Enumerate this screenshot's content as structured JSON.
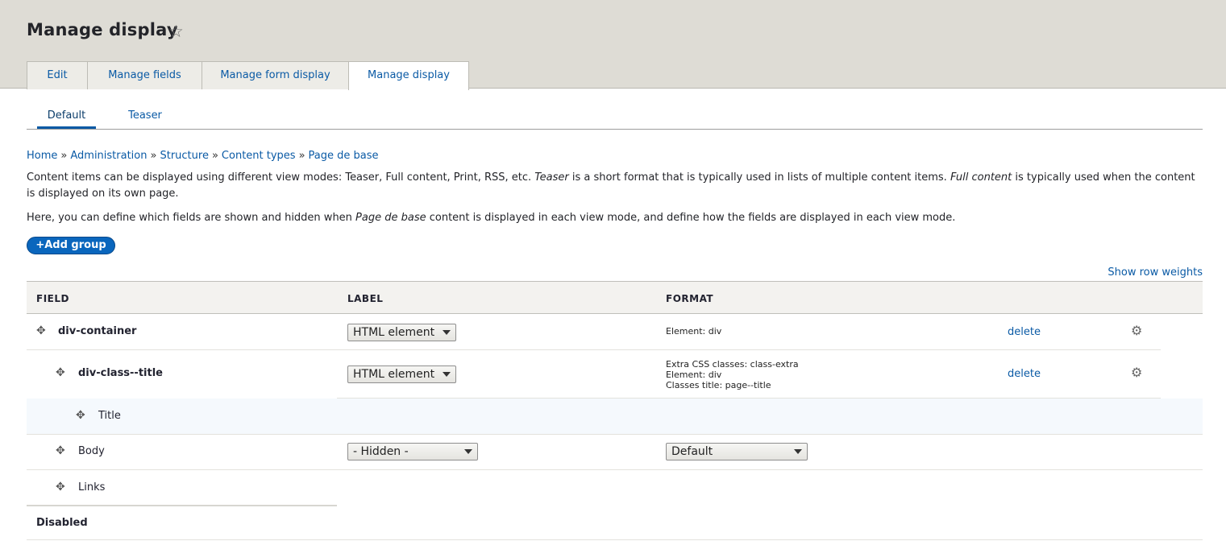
{
  "header": {
    "title": "Manage display",
    "star_icon": "☆",
    "tabs": [
      {
        "label": "Edit"
      },
      {
        "label": "Manage fields"
      },
      {
        "label": "Manage form display"
      },
      {
        "label": "Manage display"
      }
    ]
  },
  "subtabs": [
    {
      "label": "Default"
    },
    {
      "label": "Teaser"
    }
  ],
  "breadcrumb": {
    "items": [
      "Home",
      "Administration",
      "Structure",
      "Content types",
      "Page de base"
    ],
    "separator": "»"
  },
  "description": {
    "p1_a": "Content items can be displayed using different view modes: Teaser, Full content, Print, RSS, etc. ",
    "p1_em1": "Teaser",
    "p1_b": " is a short format that is typically used in lists of multiple content items. ",
    "p1_em2": "Full content",
    "p1_c": " is typically used when the content is displayed on its own page.",
    "p2_a": "Here, you can define which fields are shown and hidden when ",
    "p2_em": "Page de base",
    "p2_b": " content is displayed in each view mode, and define how the fields are displayed in each view mode."
  },
  "add_group": "+Add group",
  "show_row_weights": "Show row weights",
  "table": {
    "headers": {
      "field": "FIELD",
      "label": "LABEL",
      "format": "FORMAT"
    },
    "rows": [
      {
        "name": "div-container",
        "label_select": "HTML element",
        "format_lines": [
          "Element: div"
        ],
        "delete": "delete"
      },
      {
        "name": "div-class--title",
        "label_select": "HTML element",
        "format_lines": [
          "Extra CSS classes: class-extra",
          "Element: div",
          "Classes title: page--title"
        ],
        "delete": "delete"
      },
      {
        "name": "Title"
      },
      {
        "name": "Body",
        "label_select": "- Hidden -",
        "format_select": "Default"
      },
      {
        "name": "Links"
      }
    ],
    "disabled_label": "Disabled"
  },
  "icons": {
    "drag": "move-icon",
    "gear": "gear-icon",
    "caret": "chevron-down-icon"
  },
  "colors": {
    "link": "#0a5aa5",
    "button": "#0a66bd",
    "header_bg": "#dedcd5",
    "highlight_row": "#f5f9fd"
  }
}
